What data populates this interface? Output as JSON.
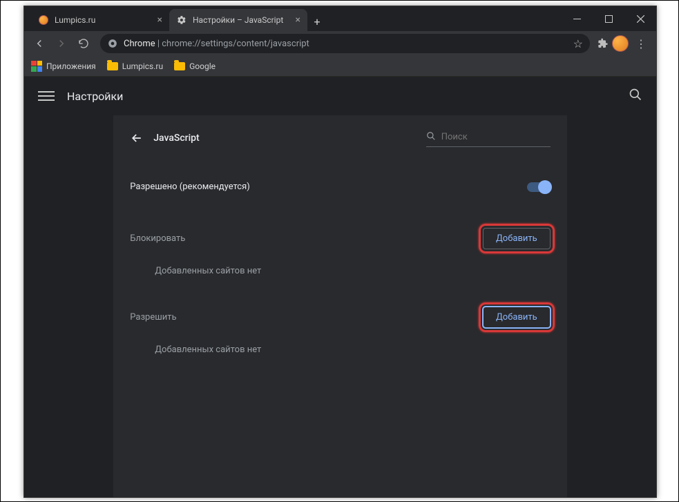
{
  "tabs": [
    {
      "title": "Lumpics.ru"
    },
    {
      "title": "Настройки – JavaScript"
    }
  ],
  "omnibox": {
    "host": "Chrome",
    "path": "chrome://settings/content/javascript"
  },
  "bookmarks": {
    "apps": "Приложения",
    "items": [
      "Lumpics.ru",
      "Google"
    ]
  },
  "settings_header": {
    "title": "Настройки"
  },
  "panel": {
    "title": "JavaScript",
    "search_placeholder": "Поиск",
    "allowed_label": "Разрешено (рекомендуется)",
    "toggle_on": true,
    "block_section": "Блокировать",
    "allow_section": "Разрешить",
    "add_button": "Добавить",
    "empty_text": "Добавленных сайтов нет"
  }
}
